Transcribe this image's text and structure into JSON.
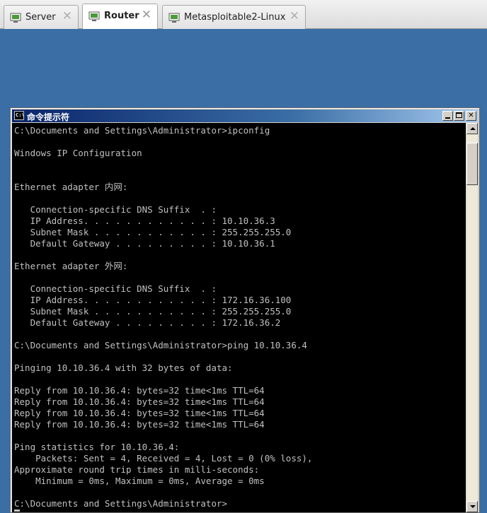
{
  "tabs": [
    {
      "label": "Server",
      "icon": "vm-icon",
      "active": false
    },
    {
      "label": "Router",
      "icon": "vm-icon",
      "active": true
    },
    {
      "label": "Metasploitable2-Linux",
      "icon": "vm-icon",
      "active": false
    }
  ],
  "tab_close_glyph": "✕",
  "console_window": {
    "title": "命令提示符",
    "icon_text": "C:\\",
    "min_glyph": "",
    "max_glyph": "",
    "close_glyph": "✕"
  },
  "console_lines": [
    "C:\\Documents and Settings\\Administrator>ipconfig",
    "",
    "Windows IP Configuration",
    "",
    "",
    "Ethernet adapter 内网:",
    "",
    "   Connection-specific DNS Suffix  . :",
    "   IP Address. . . . . . . . . . . . : 10.10.36.3",
    "   Subnet Mask . . . . . . . . . . . : 255.255.255.0",
    "   Default Gateway . . . . . . . . . : 10.10.36.1",
    "",
    "Ethernet adapter 外网:",
    "",
    "   Connection-specific DNS Suffix  . :",
    "   IP Address. . . . . . . . . . . . : 172.16.36.100",
    "   Subnet Mask . . . . . . . . . . . : 255.255.255.0",
    "   Default Gateway . . . . . . . . . : 172.16.36.2",
    "",
    "C:\\Documents and Settings\\Administrator>ping 10.10.36.4",
    "",
    "Pinging 10.10.36.4 with 32 bytes of data:",
    "",
    "Reply from 10.10.36.4: bytes=32 time<1ms TTL=64",
    "Reply from 10.10.36.4: bytes=32 time<1ms TTL=64",
    "Reply from 10.10.36.4: bytes=32 time<1ms TTL=64",
    "Reply from 10.10.36.4: bytes=32 time<1ms TTL=64",
    "",
    "Ping statistics for 10.10.36.4:",
    "    Packets: Sent = 4, Received = 4, Lost = 0 (0% loss),",
    "Approximate round trip times in milli-seconds:",
    "    Minimum = 0ms, Maximum = 0ms, Average = 0ms",
    "",
    "C:\\Documents and Settings\\Administrator>"
  ],
  "colors": {
    "desktop": "#3b6ea5",
    "console_bg": "#000000",
    "console_fg": "#c0c0c0",
    "titlebar_start": "#0a246a",
    "titlebar_end": "#a6caf0"
  }
}
